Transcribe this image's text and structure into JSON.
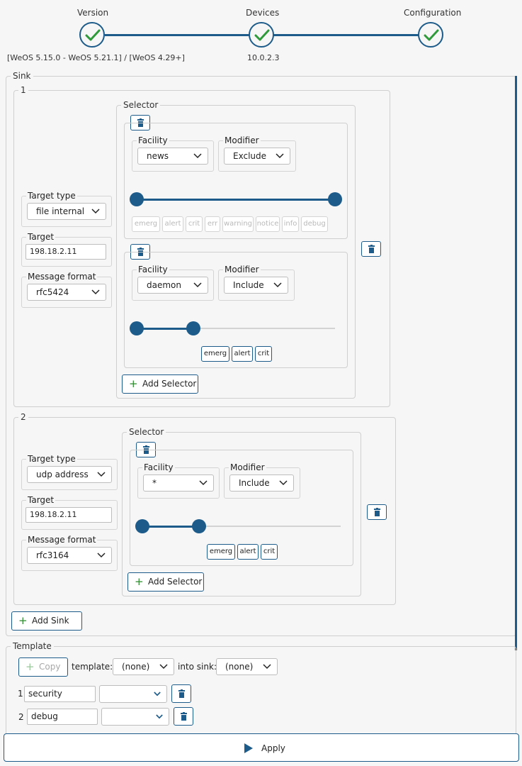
{
  "stepper": {
    "steps": [
      {
        "label": "Version",
        "sub": "[WeOS 5.15.0 - WeOS 5.21.1] / [WeOS 4.29+]"
      },
      {
        "label": "Devices",
        "sub": "10.0.2.3"
      },
      {
        "label": "Configuration",
        "sub": ""
      }
    ]
  },
  "sink": {
    "legend": "Sink",
    "sinks": [
      {
        "index": "1",
        "target_type_label": "Target type",
        "target_type": "file internal",
        "target_label": "Target",
        "target": "198.18.2.11",
        "format_label": "Message format",
        "format": "rfc5424",
        "selector_legend": "Selector",
        "selectors": [
          {
            "facility_label": "Facility",
            "facility": "news",
            "modifier_label": "Modifier",
            "modifier": "Exclude",
            "levels": [
              "emerg",
              "alert",
              "crit",
              "err",
              "warning",
              "notice",
              "info",
              "debug"
            ],
            "range_start": 0,
            "range_end": 7
          },
          {
            "facility_label": "Facility",
            "facility": "daemon",
            "modifier_label": "Modifier",
            "modifier": "Include",
            "levels": [
              "emerg",
              "alert",
              "crit"
            ],
            "range_start": 0,
            "range_end": 2
          }
        ],
        "add_selector": "Add Selector"
      },
      {
        "index": "2",
        "target_type_label": "Target type",
        "target_type": "udp address",
        "target_label": "Target",
        "target": "198.18.2.11",
        "format_label": "Message format",
        "format": "rfc3164",
        "selector_legend": "Selector",
        "selectors": [
          {
            "facility_label": "Facility",
            "facility": "*",
            "modifier_label": "Modifier",
            "modifier": "Include",
            "levels": [
              "emerg",
              "alert",
              "crit"
            ],
            "range_start": 0,
            "range_end": 2
          }
        ],
        "add_selector": "Add Selector"
      }
    ],
    "add_sink": "Add Sink"
  },
  "template": {
    "legend": "Template",
    "copy_label": "Copy",
    "template_label": "template:",
    "template_value": "(none)",
    "into_sink_label": "into sink:",
    "into_sink_value": "(none)",
    "rows": [
      {
        "index": "1",
        "name": "security",
        "select": ""
      },
      {
        "index": "2",
        "name": "debug",
        "select": ""
      }
    ]
  },
  "apply_label": "Apply",
  "colors": {
    "accent": "#1d5c8a",
    "plus": "#2c8a2c",
    "border": "#cfcfcf"
  }
}
